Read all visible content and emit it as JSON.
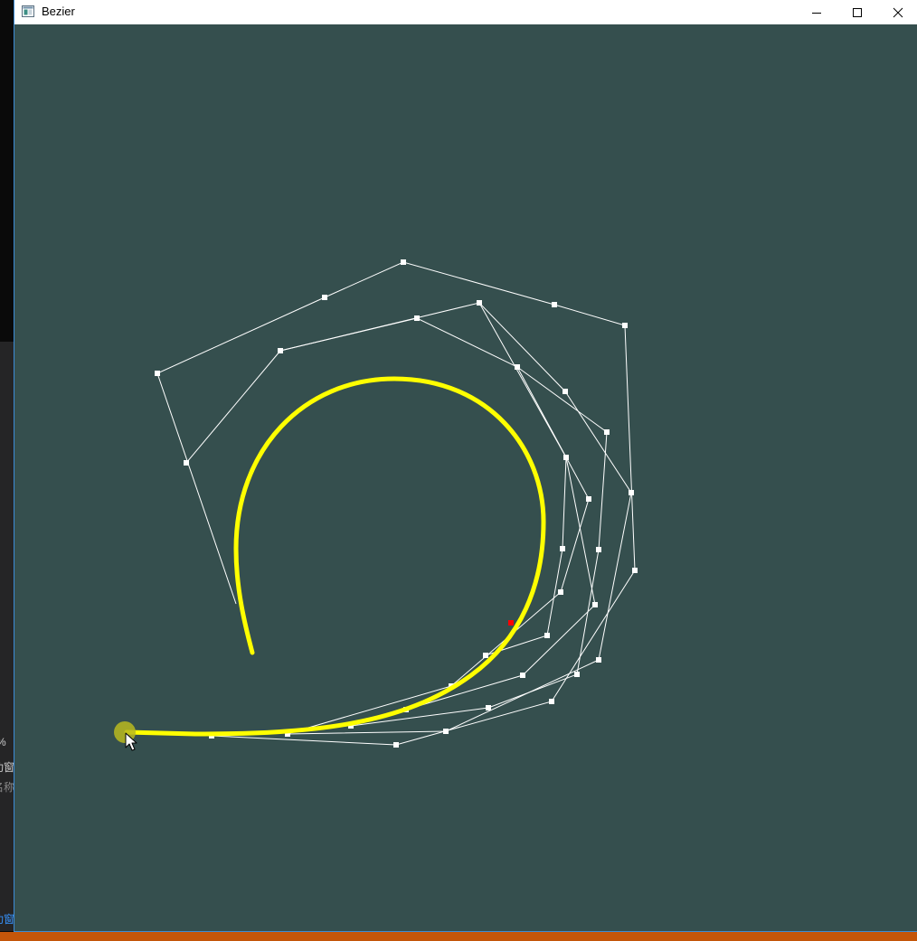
{
  "window": {
    "title": "Bezier",
    "minimize_icon": "minimize-icon",
    "maximize_icon": "maximize-icon",
    "close_icon": "close-icon"
  },
  "background_app": {
    "fragments": [
      "%",
      "功窗",
      "名称",
      "功窗"
    ]
  },
  "colors": {
    "canvas": "#354f4e",
    "curve": "#ffff00",
    "control_lines": "#ffffff",
    "current_point": "#ff0000",
    "cursor_highlight": "#b8b820"
  }
}
